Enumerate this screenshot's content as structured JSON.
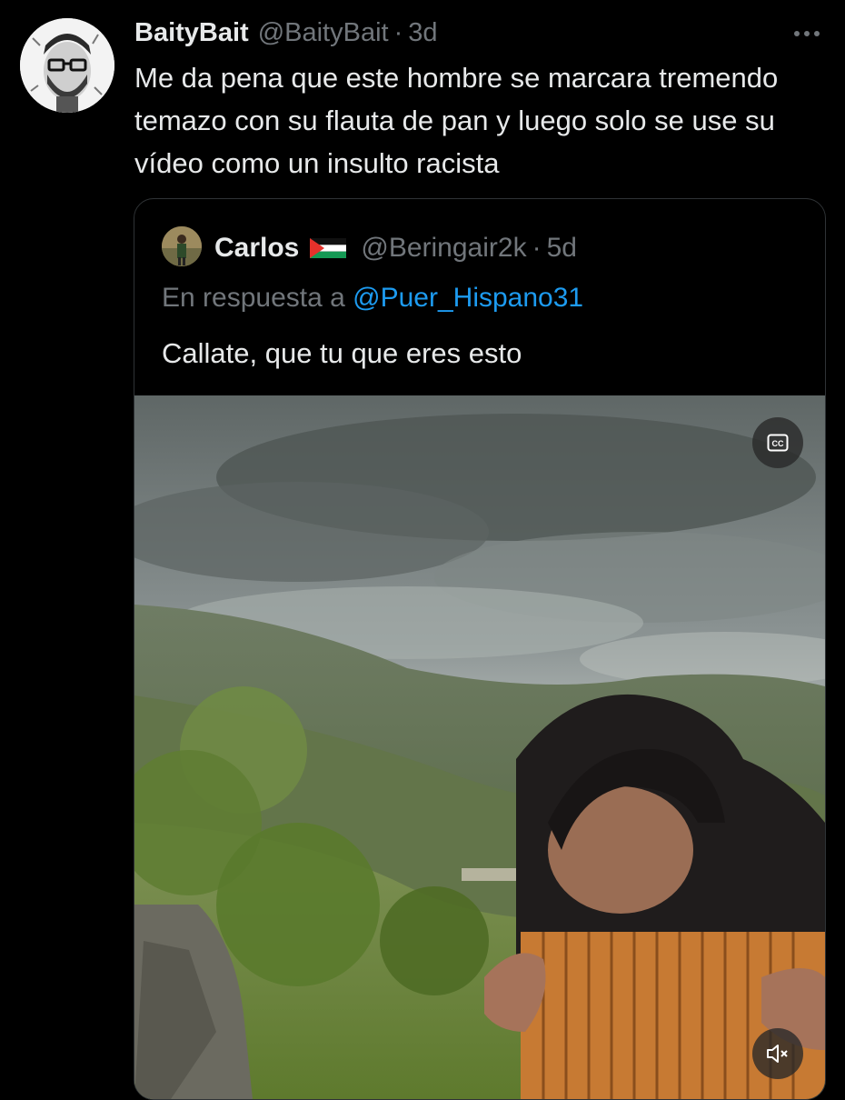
{
  "tweet": {
    "display_name": "BaityBait",
    "handle": "@BaityBait",
    "separator": "·",
    "time": "3d",
    "more_icon": "more-horizontal-icon",
    "text": "Me da pena que este hombre se marcara tremendo temazo con su flauta de pan y luego solo se use su vídeo como un insulto racista"
  },
  "quoted_tweet": {
    "display_name": "Carlos",
    "flag_icon": "palestine-flag-icon",
    "handle": "@Beringair2k",
    "separator": "·",
    "time": "5d",
    "reply_prefix": "En respuesta a",
    "reply_handle": "@Puer_Hispano31",
    "text": "Callate, que tu que eres esto",
    "video": {
      "cc_icon": "closed-captions-icon",
      "mute_icon": "volume-muted-icon"
    }
  },
  "colors": {
    "background": "#000000",
    "primary_text": "#e7e9ea",
    "secondary_text": "#71767b",
    "link": "#1d9bf0",
    "border": "#2f3336"
  }
}
